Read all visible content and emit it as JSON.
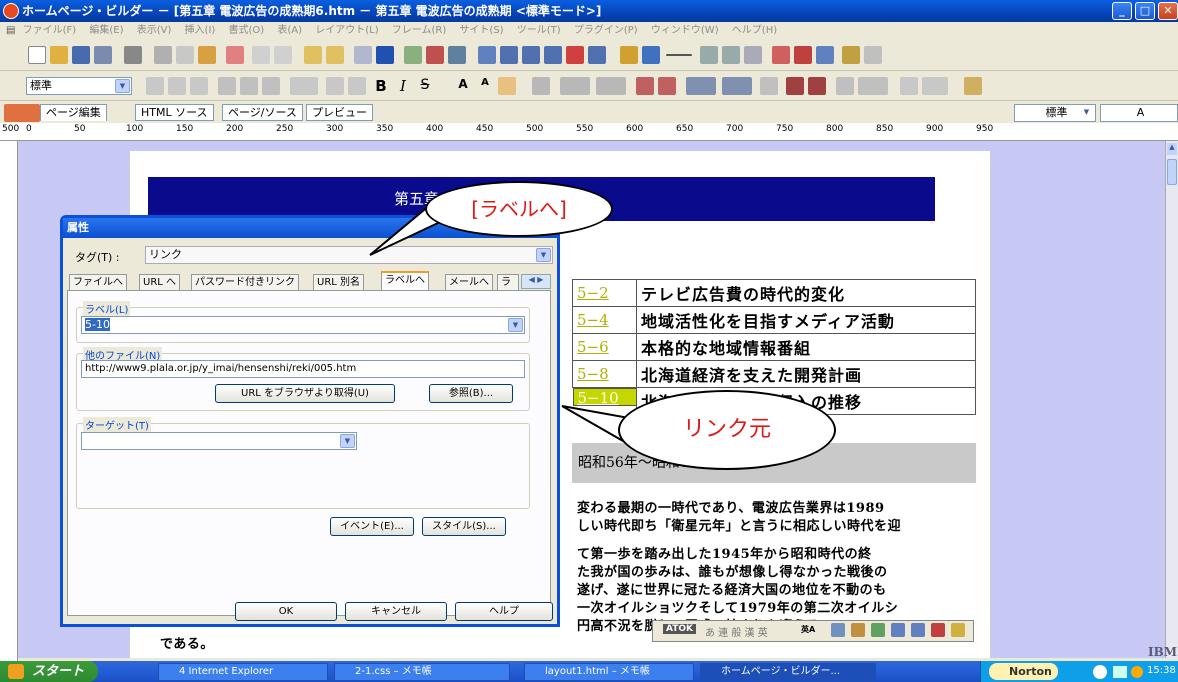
{
  "window": {
    "title": "ホームページ・ビルダー － [第五章 電波広告の成熟期6.htm － 第五章 電波広告の成熟期 <標準モード>]",
    "controls": [
      "_",
      "□",
      "✕"
    ]
  },
  "menu": [
    "ファイル(F)",
    "編集(E)",
    "表示(V)",
    "挿入(I)",
    "書式(O)",
    "表(A)",
    "レイアウト(L)",
    "フレーム(R)",
    "サイト(S)",
    "ツール(T)",
    "プラグイン(P)",
    "ウィンドウ(W)",
    "ヘルプ(H)"
  ],
  "format_toolbar": {
    "style_select": "標準",
    "size_select": "A",
    "right_select": "標準"
  },
  "page_tabs": [
    "ページ編集",
    "HTML ソース",
    "ページ/ソース",
    "プレビュー"
  ],
  "ruler": {
    "ticks": [
      "500",
      "0",
      "50",
      "100",
      "150",
      "200",
      "250",
      "300",
      "350",
      "400",
      "450",
      "500",
      "550",
      "600",
      "650",
      "700",
      "750",
      "800",
      "850",
      "900",
      "950"
    ]
  },
  "document": {
    "header_text": "第五章 電波広告の成熟期",
    "links": [
      {
        "num": "5−2",
        "label": "テレビ広告費の時代的変化"
      },
      {
        "num": "5−4",
        "label": "地域活性化を目指すメディア活動"
      },
      {
        "num": "5−6",
        "label": "本格的な地域情報番組"
      },
      {
        "num": "5−8",
        "label": "北海道経済を支えた開発計画"
      },
      {
        "num": "5−10",
        "label": "北海道の電波広告収入の推移"
      }
    ],
    "gray_heading": "昭和56年～昭和64年",
    "paragraph": [
      "変わる最期の一時代であり、電波広告業界は1989",
      "しい時代即ち「衛星元年」と言うに相応しい時代を迎",
      "て第一歩を踏み出した1945年から昭和時代の終",
      "た我が国の歩みは、誰もが想像し得なかった戦後の",
      "遂げ、遂に世界に冠たる経済大国の地位を不動のも",
      "一次オイルショツクそして1979年の第二次オイルシ",
      "円高不況を脱し、平成の始まりを迎える"
    ],
    "last_line": "である。"
  },
  "dialog": {
    "title": "属性",
    "tag_label": "タグ(T) :",
    "tag_value": "リンク",
    "tabs": [
      "ファイルへ",
      "URL へ",
      "パスワード付きリンク",
      "URL 別名",
      "ラベルへ",
      "メールへ",
      "ラ"
    ],
    "active_tab": "ラベルへ",
    "label_group": "ラベル(L)",
    "label_value": "5-10",
    "other_file_group": "他のファイル(N)",
    "other_file_value": "http://www9.plala.or.jp/y_imai/hensenshi/reki/005.htm",
    "browser_button": "URL をブラウザより取得(U)",
    "browse_button": "参照(B)...",
    "target_group": "ターゲット(T)",
    "target_value": "",
    "event_button": "イベント(E)...",
    "style_button": "スタイル(S)...",
    "ok_button": "OK",
    "cancel_button": "キャンセル",
    "help_button": "ヘルプ"
  },
  "callouts": {
    "label_to": "[ラベルへ]",
    "link_source": "リンク元"
  },
  "atok": {
    "brand": "ATOK",
    "modes": "あ 連 般 漢 英",
    "input": "英A"
  },
  "taskbar": {
    "start": "スタート",
    "tasks": [
      "4 Internet Explorer",
      "2-1.css – メモ帳",
      "layout1.html – メモ帳",
      "ホームページ・ビルダー..."
    ],
    "norton": "Norton",
    "time": "15:38"
  },
  "brand": "IBM",
  "colors": {
    "titlebar": "#0644b8",
    "doc_header": "#0a0a8c",
    "link_num": "#b0b000",
    "callout_text": "#e01818"
  }
}
